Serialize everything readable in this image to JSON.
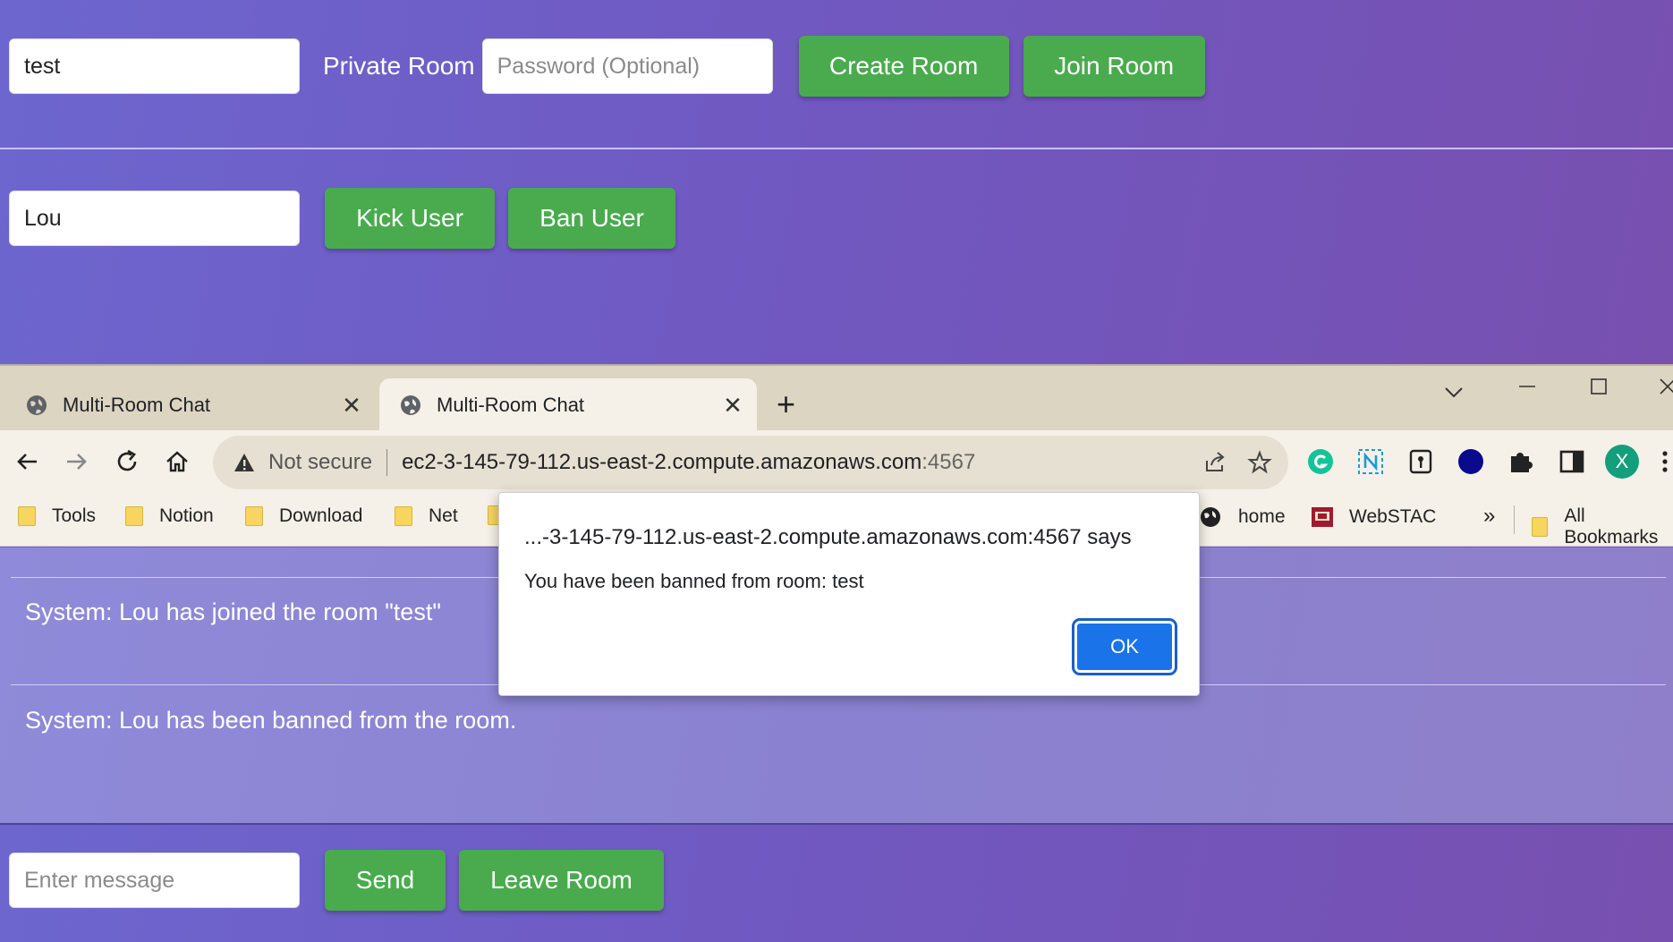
{
  "top_page": {
    "room_input_value": "test",
    "private_room_label": "Private Room",
    "password_placeholder": "Password (Optional)",
    "create_room_label": "Create Room",
    "join_room_label": "Join Room",
    "user_input_value": "Lou",
    "kick_user_label": "Kick User",
    "ban_user_label": "Ban User"
  },
  "browser": {
    "tabs": [
      {
        "title": "Multi-Room Chat",
        "active": false
      },
      {
        "title": "Multi-Room Chat",
        "active": true
      }
    ],
    "omnibox": {
      "security_text": "Not secure",
      "url_host": "ec2-3-145-79-112.us-east-2.compute.amazonaws.com",
      "url_port": ":4567"
    },
    "profile_initial": "X",
    "bookmarks": [
      "Tools",
      "Notion",
      "Download",
      "Net",
      "home",
      "WebSTAC",
      "All Bookmarks"
    ],
    "more_bookmarks": "»"
  },
  "chat": {
    "messages": [
      "System: Lou has joined the room \"test\"",
      "System: Lou has been banned from the room."
    ],
    "message_placeholder": "Enter message",
    "send_label": "Send",
    "leave_room_label": "Leave Room"
  },
  "dialog": {
    "title": "...-3-145-79-112.us-east-2.compute.amazonaws.com:4567 says",
    "message": "You have been banned from room: test",
    "ok_label": "OK"
  }
}
